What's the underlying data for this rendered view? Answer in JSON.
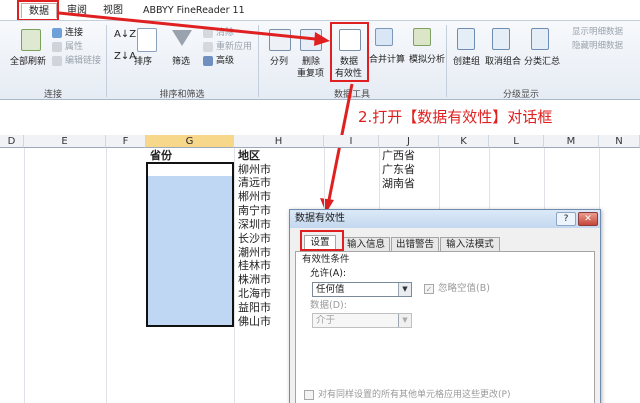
{
  "ribbon_tabs": [
    "数据",
    "审阅",
    "视图",
    "ABBYY FineReader 11"
  ],
  "ribbon": {
    "refresh_all": "全部刷新",
    "connect": "连接",
    "properties": "属性",
    "edit_links": "编辑链接",
    "group_connect": "连接",
    "sort": "排序",
    "filter": "筛选",
    "clear": "清除",
    "reapply": "重新应用",
    "advanced": "高级",
    "group_sort_filter": "排序和筛选",
    "text_to_columns": "分列",
    "remove_duplicates_1": "删除",
    "remove_duplicates_2": "重复项",
    "data_validation_1": "数据",
    "data_validation_2": "有效性",
    "consolidate": "合并计算",
    "what_if": "模拟分析",
    "group_data_tools": "数据工具",
    "group_btn": "创建组",
    "ungroup": "取消组合",
    "subtotal": "分类汇总",
    "show_detail": "显示明细数据",
    "hide_detail": "隐藏明细数据",
    "group_outline": "分级显示"
  },
  "columns": [
    "D",
    "E",
    "F",
    "G",
    "H",
    "I",
    "J",
    "K",
    "L",
    "M",
    "N"
  ],
  "annotation": "2.打开【数据有效性】对话框",
  "cells": {
    "g_header": "省份",
    "h_header": "地区",
    "h_values": [
      "柳州市",
      "清远市",
      "郴州市",
      "南宁市",
      "深圳市",
      "长沙市",
      "潮州市",
      "桂林市",
      "株洲市",
      "北海市",
      "益阳市",
      "佛山市"
    ],
    "j_values": [
      "广西省",
      "广东省",
      "湖南省"
    ]
  },
  "dialog": {
    "title": "数据有效性",
    "help": "?",
    "close": "✕",
    "tabs": [
      "设置",
      "输入信息",
      "出错警告",
      "输入法模式"
    ],
    "section": "有效性条件",
    "allow_label": "允许(A):",
    "allow_value": "任何值",
    "ignore_blank": "忽略空值(B)",
    "data_label": "数据(D):",
    "data_value": "介于",
    "apply_all": "对有同样设置的所有其他单元格应用这些更改(P)"
  }
}
